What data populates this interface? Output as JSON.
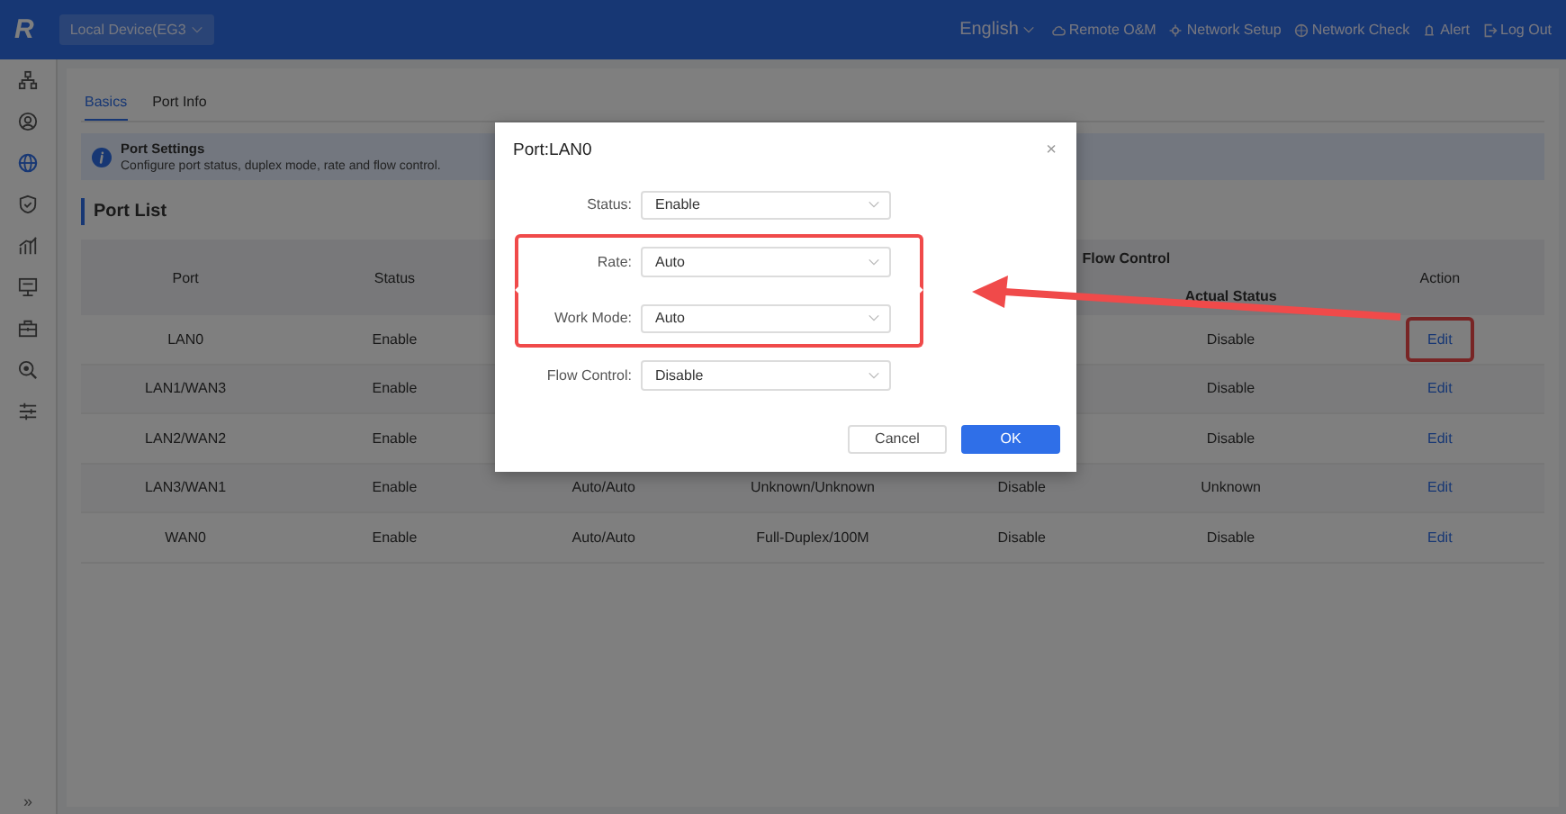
{
  "topbar": {
    "logo": "R",
    "device": "Local Device(EG3",
    "nav": [
      {
        "kind": "language",
        "label": "English"
      },
      {
        "kind": "cloud",
        "label": "Remote O&M"
      },
      {
        "kind": "setup",
        "label": "Network Setup"
      },
      {
        "kind": "check",
        "label": "Network Check"
      },
      {
        "kind": "alert",
        "label": "Alert"
      },
      {
        "kind": "logout",
        "label": "Log Out"
      }
    ]
  },
  "sidebar": {
    "items": [
      {
        "kind": "topology",
        "selected": false
      },
      {
        "kind": "user",
        "selected": false
      },
      {
        "kind": "globe",
        "selected": true
      },
      {
        "kind": "shield",
        "selected": false
      },
      {
        "kind": "chart",
        "selected": false
      },
      {
        "kind": "monitor",
        "selected": false
      },
      {
        "kind": "toolbox",
        "selected": false
      },
      {
        "kind": "diagnose",
        "selected": false
      },
      {
        "kind": "sliders",
        "selected": false
      }
    ],
    "collapse": "»"
  },
  "tabs": [
    {
      "label": "Basics",
      "selected": true
    },
    {
      "label": "Port Info",
      "selected": false
    }
  ],
  "info": {
    "title": "Port Settings",
    "text": "Configure port status, duplex mode, rate and flow control."
  },
  "section_title": "Port List",
  "table": {
    "headers": {
      "port": "Port",
      "status": "Status",
      "flow_control": "Flow Control",
      "actual_status": "Actual Status",
      "action": "Action"
    },
    "rows": [
      {
        "cells": [
          "LAN0",
          "Enable",
          null,
          null,
          null,
          "Disable"
        ],
        "action": "Edit",
        "annotated": true
      },
      {
        "cells": [
          "LAN1/WAN3",
          "Enable",
          null,
          null,
          null,
          "Disable"
        ],
        "action": "Edit",
        "annotated": false
      },
      {
        "cells": [
          "LAN2/WAN2",
          "Enable",
          null,
          null,
          null,
          "Disable"
        ],
        "action": "Edit",
        "annotated": false
      },
      {
        "cells": [
          "LAN3/WAN1",
          "Enable",
          "Auto/Auto",
          "Unknown/Unknown",
          "Disable",
          "Unknown"
        ],
        "action": "Edit",
        "annotated": false
      },
      {
        "cells": [
          "WAN0",
          "Enable",
          "Auto/Auto",
          "Full-Duplex/100M",
          "Disable",
          "Disable"
        ],
        "action": "Edit",
        "annotated": false
      }
    ]
  },
  "dialog": {
    "title": "Port:LAN0",
    "close": "×",
    "fields": [
      {
        "label": "Status:",
        "value": "Enable",
        "annotated": false
      },
      {
        "label": "Rate:",
        "value": "Auto",
        "annotated": true
      },
      {
        "label": "Work Mode:",
        "value": "Auto",
        "annotated": true
      },
      {
        "label": "Flow Control:",
        "value": "Disable",
        "annotated": false
      }
    ],
    "buttons": [
      {
        "kind": "secondary",
        "label": "Cancel"
      },
      {
        "kind": "primary",
        "label": "OK"
      }
    ]
  }
}
